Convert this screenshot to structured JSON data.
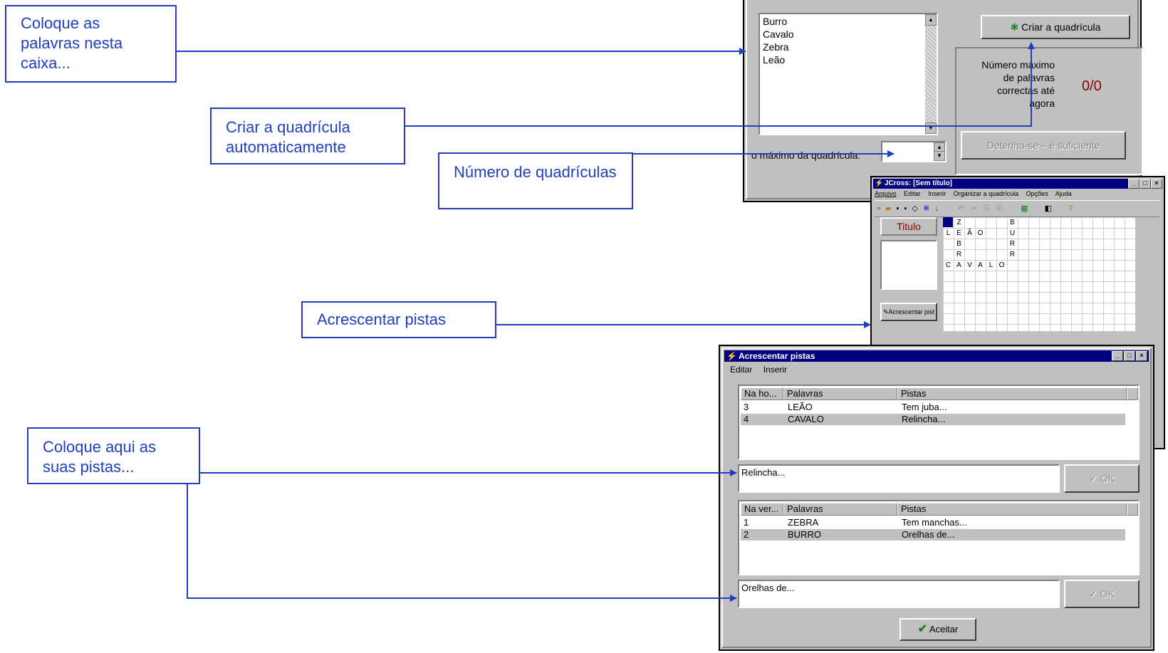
{
  "callouts": {
    "words_box": "Coloque as palavras nesta caixa...",
    "auto_grid": "Criar a quadrícula automaticamente",
    "grid_number": "Número de quadrículas",
    "add_clues": "Acrescentar pistas",
    "put_clues": "Coloque aqui as suas pistas..."
  },
  "creator_dialog": {
    "word_list": [
      "Burro",
      "Cavalo",
      "Zebra",
      "Leão"
    ],
    "create_button": "Criar a quadrícula",
    "max_words_label": "Número máximo de palavras correctas até agora",
    "score": "0/0",
    "stop_button": "Detenha-se – é suficiente",
    "max_grid_label": "o máximo da quadrícula:",
    "max_grid_value": ""
  },
  "jcross_window": {
    "title": "JCross: [Sem título]",
    "menu": [
      "Arquivo",
      "Editar",
      "Inserir",
      "Organizar a quadrícula",
      "Opções",
      "Ajuda"
    ],
    "title_field_label": "Titulo",
    "add_clues_button": "Acrescentar pist",
    "grid_letters": [
      {
        "row": 0,
        "col": 1,
        "ch": "Z"
      },
      {
        "row": 0,
        "col": 6,
        "ch": "B"
      },
      {
        "row": 1,
        "col": 0,
        "ch": "L"
      },
      {
        "row": 1,
        "col": 1,
        "ch": "E"
      },
      {
        "row": 1,
        "col": 2,
        "ch": "Ã"
      },
      {
        "row": 1,
        "col": 3,
        "ch": "O"
      },
      {
        "row": 1,
        "col": 6,
        "ch": "U"
      },
      {
        "row": 2,
        "col": 1,
        "ch": "B"
      },
      {
        "row": 2,
        "col": 6,
        "ch": "R"
      },
      {
        "row": 3,
        "col": 1,
        "ch": "R"
      },
      {
        "row": 3,
        "col": 6,
        "ch": "R"
      },
      {
        "row": 4,
        "col": 0,
        "ch": "C"
      },
      {
        "row": 4,
        "col": 1,
        "ch": "A"
      },
      {
        "row": 4,
        "col": 2,
        "ch": "V"
      },
      {
        "row": 4,
        "col": 3,
        "ch": "A"
      },
      {
        "row": 4,
        "col": 4,
        "ch": "L"
      },
      {
        "row": 4,
        "col": 5,
        "ch": "O"
      }
    ]
  },
  "clues_window": {
    "title": "Acrescentar pistas",
    "menu": [
      "Editar",
      "Inserir"
    ],
    "across_headers": [
      "Na ho...",
      "Palavras",
      "Pistas"
    ],
    "across_rows": [
      {
        "num": "3",
        "word": "LEÃO",
        "clue": "Tem juba..."
      },
      {
        "num": "4",
        "word": "CAVALO",
        "clue": "Relincha..."
      }
    ],
    "across_input": "Relincha...",
    "down_headers": [
      "Na ver...",
      "Palavras",
      "Pistas"
    ],
    "down_rows": [
      {
        "num": "1",
        "word": "ZEBRA",
        "clue": "Tem manchas..."
      },
      {
        "num": "2",
        "word": "BURRO",
        "clue": "Orelhas de..."
      }
    ],
    "down_input": "Orelhas de...",
    "ok_label": "OK",
    "accept_button": "Aceitar"
  },
  "colors": {
    "callout_blue": "#1f3fbf",
    "title_blue": "#000080",
    "window_gray": "#c0c0c0",
    "score_red": "#8b0000"
  }
}
